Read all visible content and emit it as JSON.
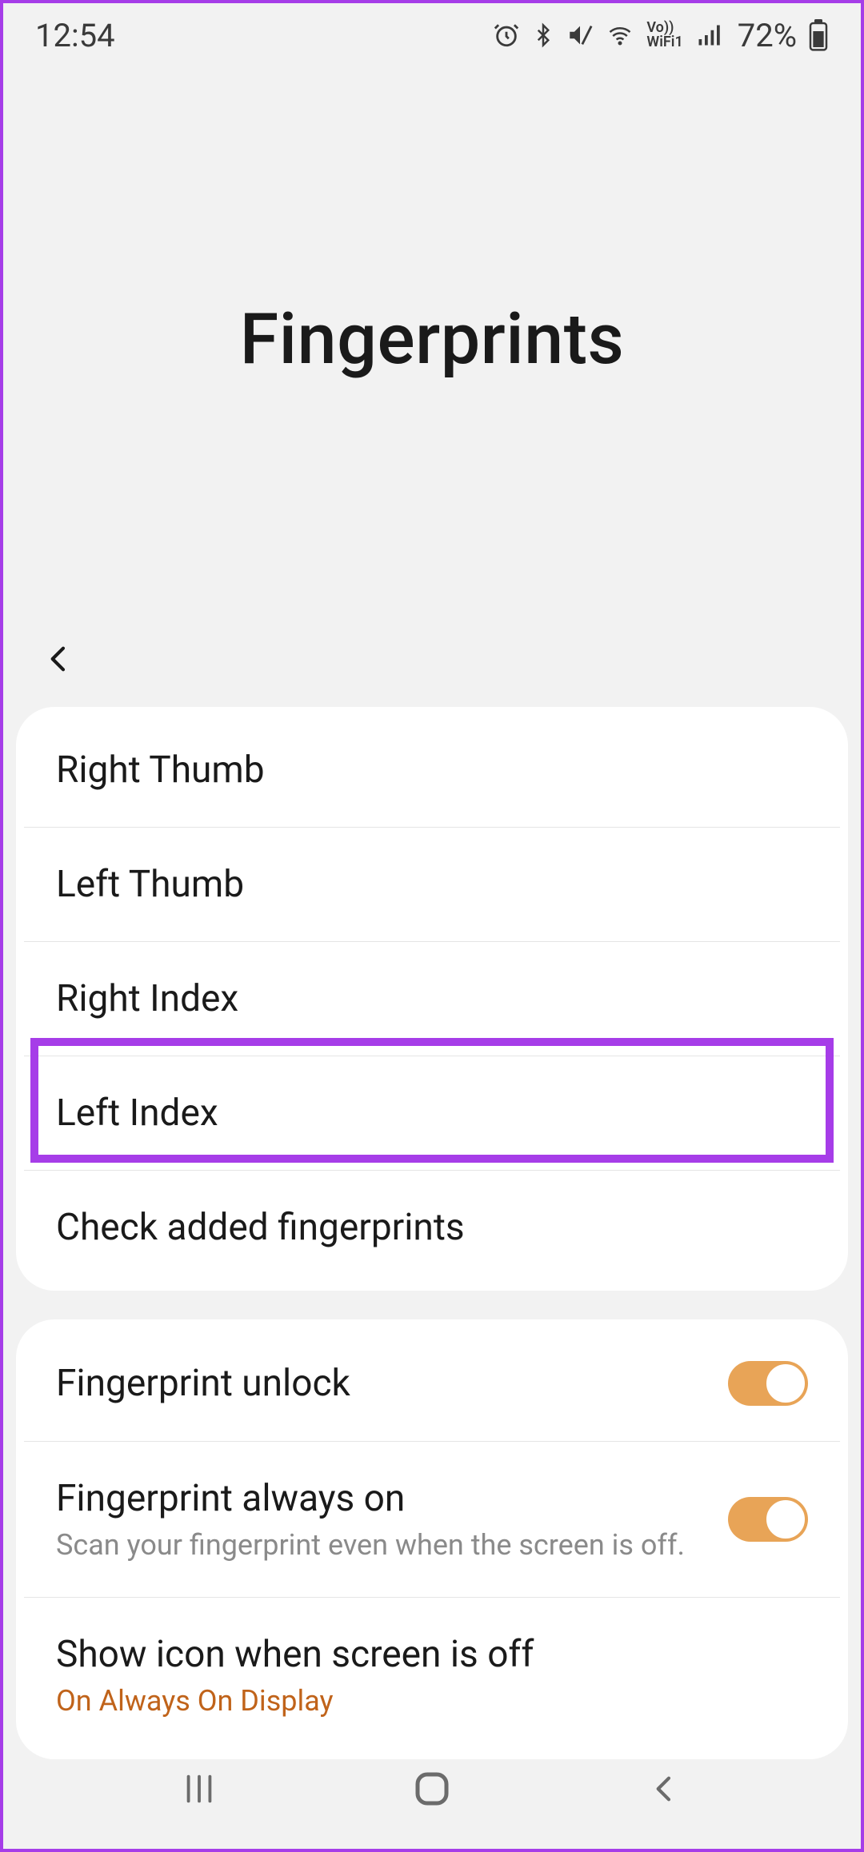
{
  "status": {
    "time": "12:54",
    "battery": "72%",
    "icons": [
      "alarm",
      "bluetooth",
      "mute",
      "wifi",
      "vowifi",
      "signal"
    ]
  },
  "page": {
    "title": "Fingerprints"
  },
  "fingerprints": [
    "Right Thumb",
    "Left Thumb",
    "Right Index",
    "Left Index"
  ],
  "highlighted_index": 3,
  "check_label": "Check added fingerprints",
  "settings": {
    "unlock": {
      "label": "Fingerprint unlock",
      "on": true
    },
    "always_on": {
      "label": "Fingerprint always on",
      "sub": "Scan your fingerprint even when the screen is off.",
      "on": true
    },
    "show_icon": {
      "label": "Show icon when screen is off",
      "value": "On Always On Display"
    }
  }
}
